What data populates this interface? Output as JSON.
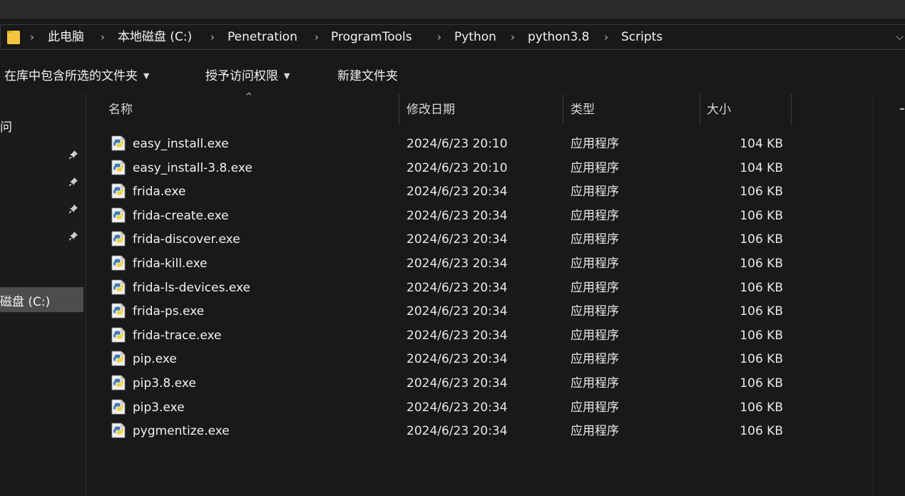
{
  "breadcrumb": {
    "items": [
      "此电脑",
      "本地磁盘 (C:)",
      "Penetration",
      "ProgramTools",
      "Python",
      "python3.8",
      "Scripts"
    ],
    "separator": "›",
    "dropdown": "⌵"
  },
  "commands": {
    "include_in_library": "在库中包含所选的文件夹",
    "grant_access": "授予访问权限",
    "new_folder": "新建文件夹",
    "caret": "▼"
  },
  "nav": {
    "partial_label_top": "问",
    "drive_label": "磁盘 (C:)"
  },
  "columns": {
    "name": "名称",
    "modified": "修改日期",
    "type": "类型",
    "size": "大小",
    "sort_indicator": "^"
  },
  "files": [
    {
      "name": "easy_install.exe",
      "modified": "2024/6/23 20:10",
      "type": "应用程序",
      "size": "104 KB"
    },
    {
      "name": "easy_install-3.8.exe",
      "modified": "2024/6/23 20:10",
      "type": "应用程序",
      "size": "104 KB"
    },
    {
      "name": "frida.exe",
      "modified": "2024/6/23 20:34",
      "type": "应用程序",
      "size": "106 KB"
    },
    {
      "name": "frida-create.exe",
      "modified": "2024/6/23 20:34",
      "type": "应用程序",
      "size": "106 KB"
    },
    {
      "name": "frida-discover.exe",
      "modified": "2024/6/23 20:34",
      "type": "应用程序",
      "size": "106 KB"
    },
    {
      "name": "frida-kill.exe",
      "modified": "2024/6/23 20:34",
      "type": "应用程序",
      "size": "106 KB"
    },
    {
      "name": "frida-ls-devices.exe",
      "modified": "2024/6/23 20:34",
      "type": "应用程序",
      "size": "106 KB"
    },
    {
      "name": "frida-ps.exe",
      "modified": "2024/6/23 20:34",
      "type": "应用程序",
      "size": "106 KB"
    },
    {
      "name": "frida-trace.exe",
      "modified": "2024/6/23 20:34",
      "type": "应用程序",
      "size": "106 KB"
    },
    {
      "name": "pip.exe",
      "modified": "2024/6/23 20:34",
      "type": "应用程序",
      "size": "106 KB"
    },
    {
      "name": "pip3.8.exe",
      "modified": "2024/6/23 20:34",
      "type": "应用程序",
      "size": "106 KB"
    },
    {
      "name": "pip3.exe",
      "modified": "2024/6/23 20:34",
      "type": "应用程序",
      "size": "106 KB"
    },
    {
      "name": "pygmentize.exe",
      "modified": "2024/6/23 20:34",
      "type": "应用程序",
      "size": "106 KB"
    }
  ],
  "icons": {
    "folder": "folder-icon",
    "pin": "pin-icon",
    "file": "python-executable-icon"
  },
  "colors": {
    "background": "#191919",
    "selected_nav": "#4d4d4d",
    "folder_yellow": "#f5c542",
    "python_blue": "#3d7ab8",
    "python_yellow": "#f6d045"
  }
}
